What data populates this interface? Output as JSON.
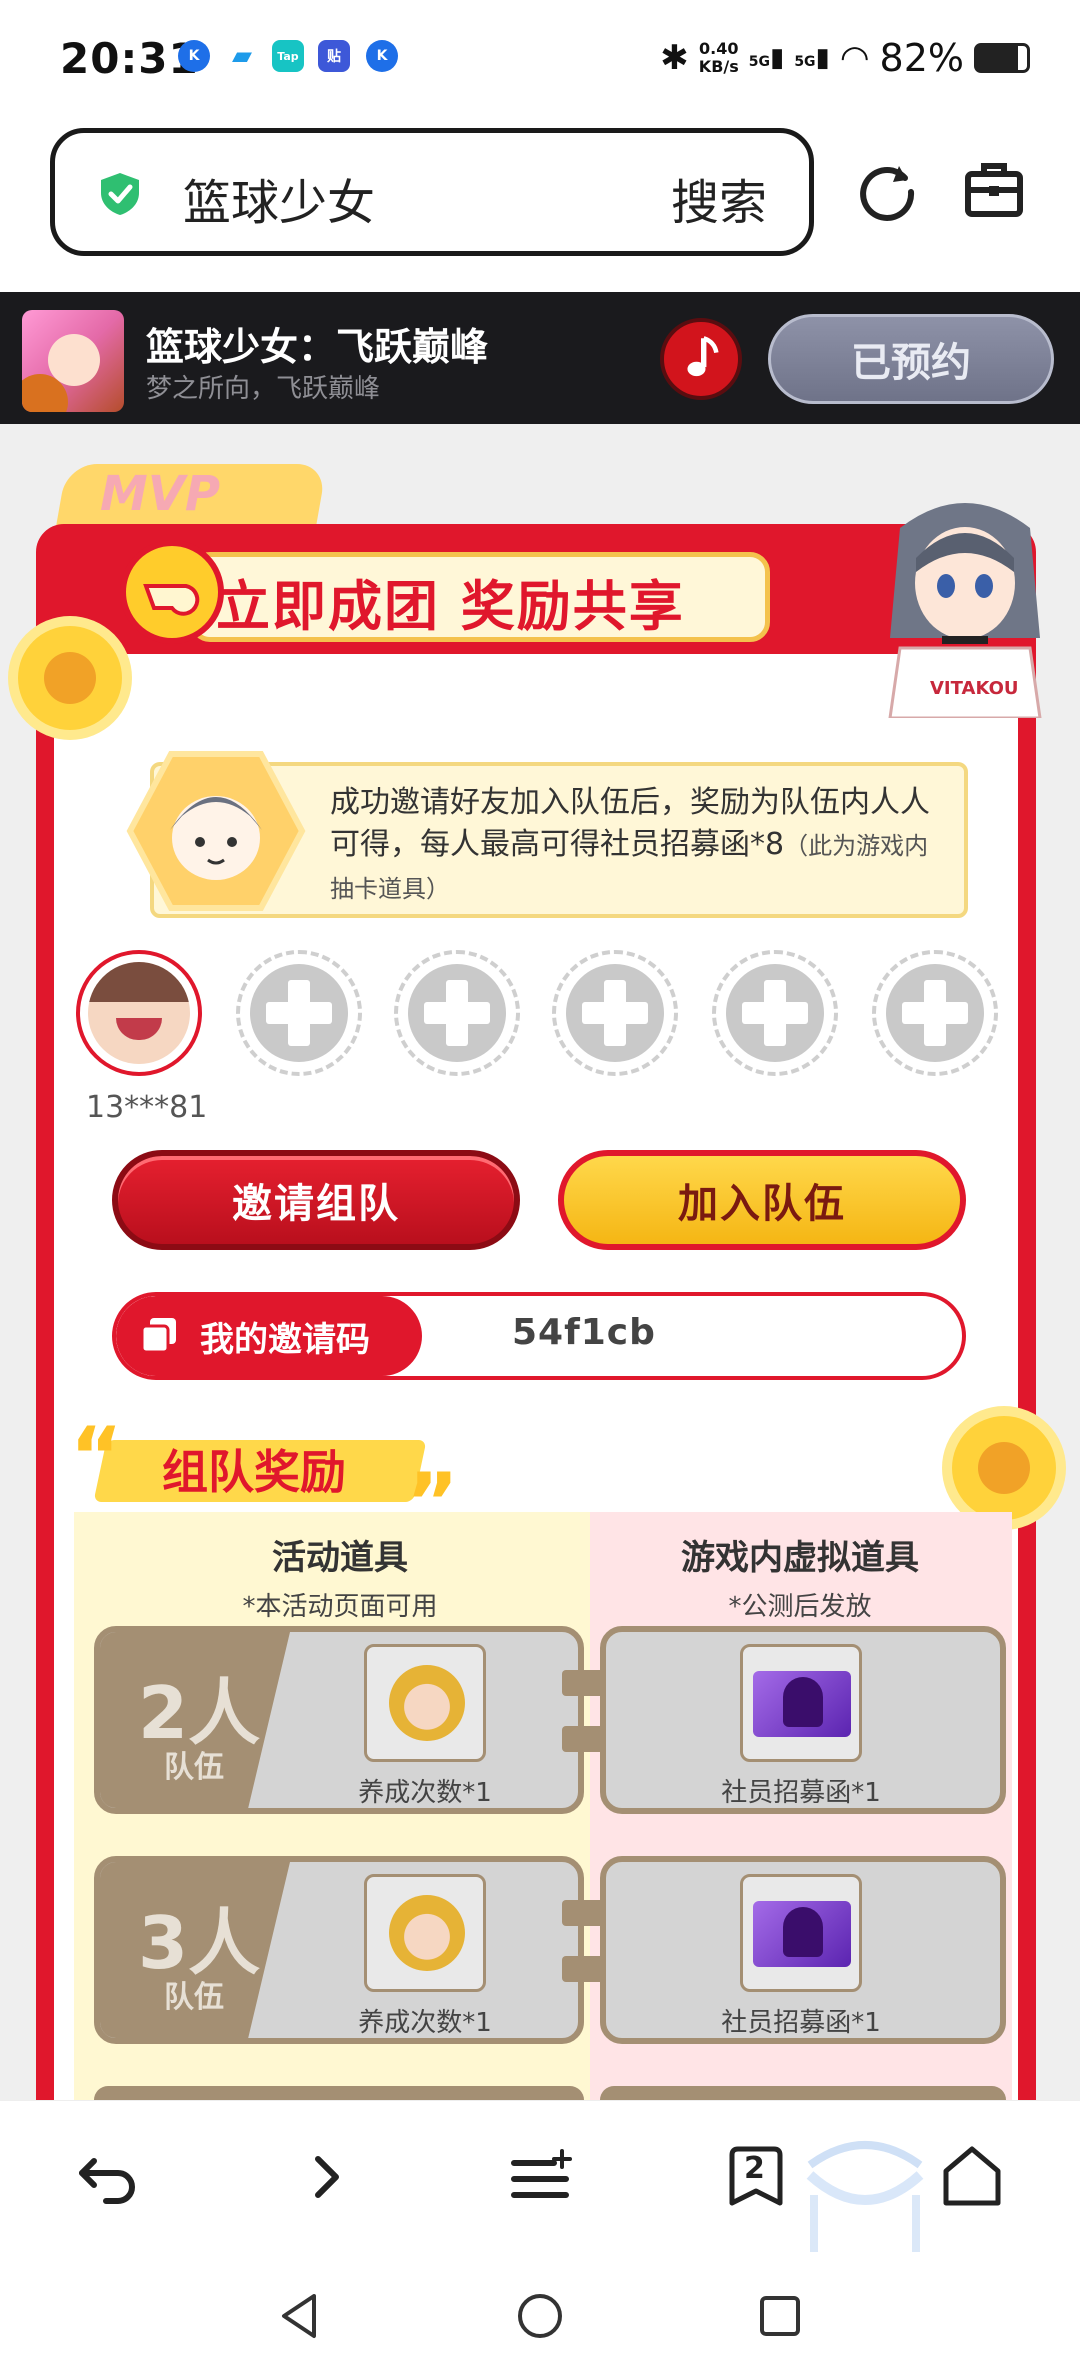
{
  "status_bar": {
    "time": "20:31",
    "net_speed_value": "0.40",
    "net_speed_unit": "KB/s",
    "signal1": "5G",
    "signal2": "5G",
    "battery": "82%"
  },
  "search": {
    "query": "篮球少女",
    "button": "搜索"
  },
  "banner": {
    "game_name": "篮球少女：飞跃巅峰",
    "slogan": "梦之所向，飞跃巅峰",
    "reserve_label": "已预约"
  },
  "panel": {
    "badge_text": "MVP",
    "title": "立即成团 奖励共享",
    "info_text": "成功邀请好友加入队伍后，奖励为队伍内人人可得，每人最高可得社员招募函*8",
    "info_note": "（此为游戏内抽卡道具）",
    "member_id": "13***81",
    "invite_button": "邀请组队",
    "join_button": "加入队伍",
    "code_label": "我的邀请码",
    "code_value": "54f1cb"
  },
  "rewards": {
    "title": "组队奖励",
    "left_header": "活动道具",
    "left_sub": "*本活动页面可用",
    "right_header": "游戏内虚拟道具",
    "right_sub": "*公测后发放",
    "tiers": [
      {
        "num": "2人",
        "unit": "队伍",
        "left_item": "养成次数*1",
        "right_item": "社员招募函*1"
      },
      {
        "num": "3人",
        "unit": "队伍",
        "left_item": "养成次数*1",
        "right_item": "社员招募函*1"
      }
    ]
  },
  "bottom_nav": {
    "tab_count": "2"
  },
  "colors": {
    "brand_red": "#e0172c",
    "gold": "#ffc226",
    "tier_brown": "#a48f73"
  }
}
